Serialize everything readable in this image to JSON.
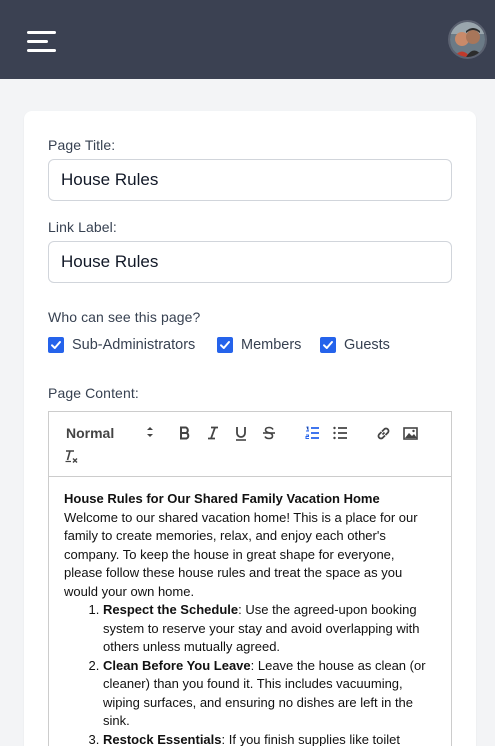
{
  "header": {
    "menu_icon": "hamburger-menu-icon",
    "avatar_icon": "user-avatar",
    "background": "#3b4152"
  },
  "form": {
    "page_title_label": "Page Title:",
    "page_title_value": "House Rules",
    "link_label_label": "Link Label:",
    "link_label_value": "House Rules",
    "visibility_label": "Who can see this page?",
    "visibility_options": [
      {
        "label": "Sub-Administrators",
        "checked": true
      },
      {
        "label": "Members",
        "checked": true
      },
      {
        "label": "Guests",
        "checked": true
      }
    ],
    "content_label": "Page Content:"
  },
  "toolbar": {
    "format_select": "Normal",
    "buttons": [
      "bold-icon",
      "italic-icon",
      "underline-icon",
      "strikethrough-icon",
      "ordered-list-icon",
      "bullet-list-icon",
      "link-icon",
      "image-icon",
      "clear-format-icon"
    ],
    "active_color": "#2563eb"
  },
  "editor": {
    "title": "House Rules for Our Shared Family Vacation Home",
    "intro": "Welcome to our shared vacation home! This is a place for our family to create memories, relax, and enjoy each other's company. To keep the house in great shape for everyone, please follow these house rules and treat the space as you would your own home.",
    "rules": [
      {
        "heading": "Respect the Schedule",
        "text": ": Use the agreed-upon booking system to reserve your stay and avoid overlapping with others unless mutually agreed."
      },
      {
        "heading": "Clean Before You Leave",
        "text": ": Leave the house as clean (or cleaner) than you found it. This includes vacuuming, wiping surfaces, and ensuring no dishes are left in the sink."
      },
      {
        "heading": "Restock Essentials",
        "text": ": If you finish supplies like toilet"
      }
    ]
  },
  "colors": {
    "checkbox": "#2563eb",
    "page_background": "#f3f4f6"
  }
}
